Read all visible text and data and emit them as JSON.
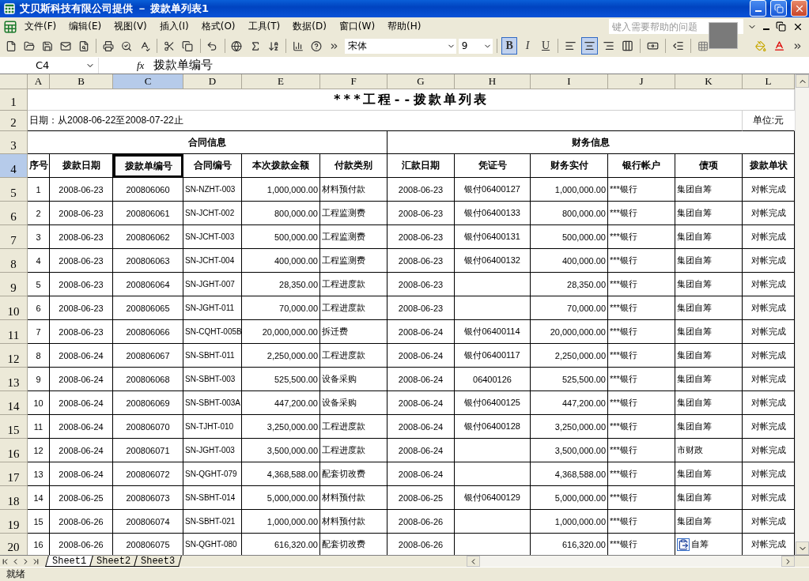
{
  "window": {
    "title": "艾贝斯科技有限公司提供 － 拨款单列表1"
  },
  "menu": [
    "文件(F)",
    "编辑(E)",
    "视图(V)",
    "插入(I)",
    "格式(O)",
    "工具(T)",
    "数据(D)",
    "窗口(W)",
    "帮助(H)"
  ],
  "help_search": {
    "placeholder": "键入需要帮助的问题"
  },
  "toolbar": {
    "font": "宋体",
    "size": "9",
    "format_buttons": [
      {
        "kind": "bold",
        "label": "B",
        "selected": true
      },
      {
        "kind": "italic",
        "label": "I",
        "selected": false
      },
      {
        "kind": "underline",
        "label": "U",
        "selected": false
      },
      {
        "kind": "align_left",
        "selected": false
      },
      {
        "kind": "align_center",
        "selected": true
      },
      {
        "kind": "align_right",
        "selected": false
      },
      {
        "kind": "merge",
        "selected": false
      }
    ]
  },
  "formula_bar": {
    "name_box": "C4",
    "function_label": "fx",
    "value": "拨款单编号"
  },
  "sheet": {
    "columns": [
      {
        "label": "A",
        "selected": false
      },
      {
        "label": "B",
        "selected": false
      },
      {
        "label": "C",
        "selected": true
      },
      {
        "label": "D",
        "selected": false
      },
      {
        "label": "E",
        "selected": false
      },
      {
        "label": "F",
        "selected": false
      },
      {
        "label": "G",
        "selected": false
      },
      {
        "label": "H",
        "selected": false
      },
      {
        "label": "I",
        "selected": false
      },
      {
        "label": "J",
        "selected": false
      },
      {
        "label": "K",
        "selected": false
      },
      {
        "label": "L",
        "selected": false
      }
    ],
    "rows": [
      {
        "label": "1",
        "selected": false
      },
      {
        "label": "2",
        "selected": false
      },
      {
        "label": "3",
        "selected": false
      },
      {
        "label": "4",
        "selected": true
      },
      {
        "label": "5",
        "selected": false
      },
      {
        "label": "6",
        "selected": false
      },
      {
        "label": "7",
        "selected": false
      },
      {
        "label": "8",
        "selected": false
      },
      {
        "label": "9",
        "selected": false
      },
      {
        "label": "10",
        "selected": false
      },
      {
        "label": "11",
        "selected": false
      },
      {
        "label": "12",
        "selected": false
      },
      {
        "label": "13",
        "selected": false
      },
      {
        "label": "14",
        "selected": false
      },
      {
        "label": "15",
        "selected": false
      },
      {
        "label": "16",
        "selected": false
      },
      {
        "label": "17",
        "selected": false
      },
      {
        "label": "18",
        "selected": false
      },
      {
        "label": "19",
        "selected": false
      },
      {
        "label": "20",
        "selected": false
      }
    ],
    "title": "***工程--拨款单列表",
    "date_range": "日期：从2008-06-22至2008-07-22止",
    "unit": "单位:元",
    "groups": [
      "合同信息",
      "财务信息"
    ],
    "headers": [
      {
        "text": "序号",
        "selected": false
      },
      {
        "text": "拨款日期",
        "selected": false
      },
      {
        "text": "拨款单编号",
        "selected": true
      },
      {
        "text": "合同编号",
        "selected": false
      },
      {
        "text": "本次拨款金额",
        "selected": false
      },
      {
        "text": "付款类别",
        "selected": false
      },
      {
        "text": "汇款日期",
        "selected": false
      },
      {
        "text": "凭证号",
        "selected": false
      },
      {
        "text": "财务实付",
        "selected": false
      },
      {
        "text": "银行帐户",
        "selected": false
      },
      {
        "text": "债项",
        "selected": false
      },
      {
        "text": "拨款单状",
        "selected": false
      }
    ],
    "records": [
      {
        "no": "1",
        "date": "2008-06-23",
        "number": "200806060",
        "contract": "SN-NZHT-003",
        "amount": "1,000,000.00",
        "category": "材料预付款",
        "remit_date": "2008-06-23",
        "voucher": "银付06400127",
        "paid": "1,000,000.00",
        "bank": "***银行",
        "fund": "集团自筹",
        "status": "对帐完成",
        "paste_options": false
      },
      {
        "no": "2",
        "date": "2008-06-23",
        "number": "200806061",
        "contract": "SN-JCHT-002",
        "amount": "800,000.00",
        "category": "工程监测费",
        "remit_date": "2008-06-23",
        "voucher": "银付06400133",
        "paid": "800,000.00",
        "bank": "***银行",
        "fund": "集团自筹",
        "status": "对帐完成",
        "paste_options": false
      },
      {
        "no": "3",
        "date": "2008-06-23",
        "number": "200806062",
        "contract": "SN-JCHT-003",
        "amount": "500,000.00",
        "category": "工程监测费",
        "remit_date": "2008-06-23",
        "voucher": "银付06400131",
        "paid": "500,000.00",
        "bank": "***银行",
        "fund": "集团自筹",
        "status": "对帐完成",
        "paste_options": false
      },
      {
        "no": "4",
        "date": "2008-06-23",
        "number": "200806063",
        "contract": "SN-JCHT-004",
        "amount": "400,000.00",
        "category": "工程监测费",
        "remit_date": "2008-06-23",
        "voucher": "银付06400132",
        "paid": "400,000.00",
        "bank": "***银行",
        "fund": "集团自筹",
        "status": "对帐完成",
        "paste_options": false
      },
      {
        "no": "5",
        "date": "2008-06-23",
        "number": "200806064",
        "contract": "SN-JGHT-007",
        "amount": "28,350.00",
        "category": "工程进度款",
        "remit_date": "2008-06-23",
        "paid": "28,350.00",
        "bank": "***银行",
        "fund": "集团自筹",
        "status": "对帐完成",
        "paste_options": false
      },
      {
        "no": "6",
        "date": "2008-06-23",
        "number": "200806065",
        "contract": "SN-JGHT-011",
        "amount": "70,000.00",
        "category": "工程进度款",
        "remit_date": "2008-06-23",
        "paid": "70,000.00",
        "bank": "***银行",
        "fund": "集团自筹",
        "status": "对帐完成",
        "paste_options": false
      },
      {
        "no": "7",
        "date": "2008-06-23",
        "number": "200806066",
        "contract": "SN-CQHT-005B",
        "amount": "20,000,000.00",
        "category": "拆迁费",
        "remit_date": "2008-06-24",
        "voucher": "银付06400114",
        "paid": "20,000,000.00",
        "bank": "***银行",
        "fund": "集团自筹",
        "status": "对帐完成",
        "paste_options": false
      },
      {
        "no": "8",
        "date": "2008-06-24",
        "number": "200806067",
        "contract": "SN-SBHT-011",
        "amount": "2,250,000.00",
        "category": "工程进度款",
        "remit_date": "2008-06-24",
        "voucher": "银付06400117",
        "paid": "2,250,000.00",
        "bank": "***银行",
        "fund": "集团自筹",
        "status": "对帐完成",
        "paste_options": false
      },
      {
        "no": "9",
        "date": "2008-06-24",
        "number": "200806068",
        "contract": "SN-SBHT-003",
        "amount": "525,500.00",
        "category": "设备采购",
        "remit_date": "2008-06-24",
        "voucher": "06400126",
        "paid": "525,500.00",
        "bank": "***银行",
        "fund": "集团自筹",
        "status": "对帐完成",
        "paste_options": false
      },
      {
        "no": "10",
        "date": "2008-06-24",
        "number": "200806069",
        "contract": "SN-SBHT-003A",
        "amount": "447,200.00",
        "category": "设备采购",
        "remit_date": "2008-06-24",
        "voucher": "银付06400125",
        "paid": "447,200.00",
        "bank": "***银行",
        "fund": "集团自筹",
        "status": "对帐完成",
        "paste_options": false
      },
      {
        "no": "11",
        "date": "2008-06-24",
        "number": "200806070",
        "contract": "SN-TJHT-010",
        "amount": "3,250,000.00",
        "category": "工程进度款",
        "remit_date": "2008-06-24",
        "voucher": "银付06400128",
        "paid": "3,250,000.00",
        "bank": "***银行",
        "fund": "集团自筹",
        "status": "对帐完成",
        "paste_options": false
      },
      {
        "no": "12",
        "date": "2008-06-24",
        "number": "200806071",
        "contract": "SN-JGHT-003",
        "amount": "3,500,000.00",
        "category": "工程进度款",
        "remit_date": "2008-06-24",
        "paid": "3,500,000.00",
        "bank": "***银行",
        "fund": "市财政",
        "status": "对帐完成",
        "paste_options": false
      },
      {
        "no": "13",
        "date": "2008-06-24",
        "number": "200806072",
        "contract": "SN-QGHT-079",
        "amount": "4,368,588.00",
        "category": "配套切改费",
        "remit_date": "2008-06-24",
        "paid": "4,368,588.00",
        "bank": "***银行",
        "fund": "集团自筹",
        "status": "对帐完成",
        "paste_options": false
      },
      {
        "no": "14",
        "date": "2008-06-25",
        "number": "200806073",
        "contract": "SN-SBHT-014",
        "amount": "5,000,000.00",
        "category": "材料预付款",
        "remit_date": "2008-06-25",
        "voucher": "银付06400129",
        "paid": "5,000,000.00",
        "bank": "***银行",
        "fund": "集团自筹",
        "status": "对帐完成",
        "paste_options": false
      },
      {
        "no": "15",
        "date": "2008-06-26",
        "number": "200806074",
        "contract": "SN-SBHT-021",
        "amount": "1,000,000.00",
        "category": "材料预付款",
        "remit_date": "2008-06-26",
        "paid": "1,000,000.00",
        "bank": "***银行",
        "fund": "集团自筹",
        "status": "对帐完成",
        "paste_options": false
      },
      {
        "no": "16",
        "date": "2008-06-26",
        "number": "200806075",
        "contract": "SN-QGHT-080",
        "amount": "616,320.00",
        "category": "配套切改费",
        "remit_date": "2008-06-26",
        "paid": "616,320.00",
        "bank": "***银行",
        "fund": "自筹",
        "status": "对帐完成",
        "paste_options": true
      }
    ]
  },
  "sheet_tabs": [
    {
      "label": "Sheet1",
      "selected": true
    },
    {
      "label": "Sheet2",
      "selected": false
    },
    {
      "label": "Sheet3",
      "selected": false
    }
  ],
  "status_bar": "就绪"
}
